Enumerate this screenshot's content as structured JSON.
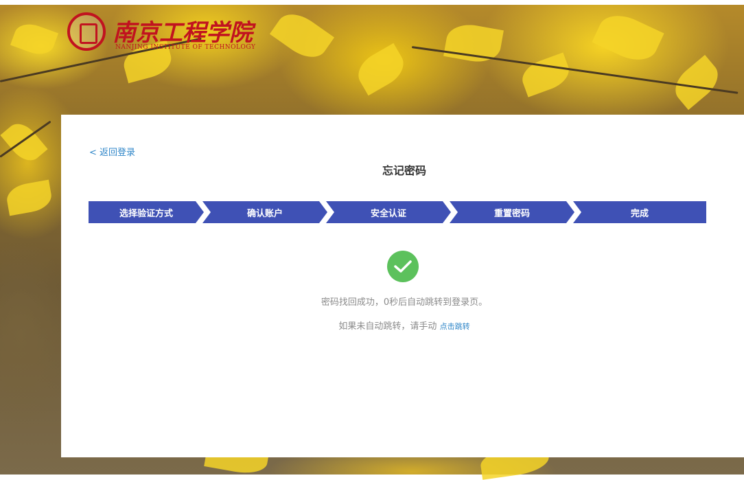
{
  "header": {
    "logo_cn": "南京工程学院",
    "logo_en": "NANJING INSTITUTE OF TECHNOLOGY"
  },
  "card": {
    "back_link": "< 返回登录",
    "title": "忘记密码",
    "steps": [
      {
        "label": "选择验证方式"
      },
      {
        "label": "确认账户"
      },
      {
        "label": "安全认证"
      },
      {
        "label": "重置密码"
      },
      {
        "label": "完成"
      }
    ],
    "success_icon": "check-circle-icon",
    "message": "密码找回成功，0秒后自动跳转到登录页。",
    "fallback_text": "如果未自动跳转，请手动",
    "fallback_link": "点击跳转"
  },
  "colors": {
    "step_bg": "#3f51b5",
    "link": "#2f86c8",
    "success": "#5cc15c",
    "logo": "#c1121f"
  }
}
